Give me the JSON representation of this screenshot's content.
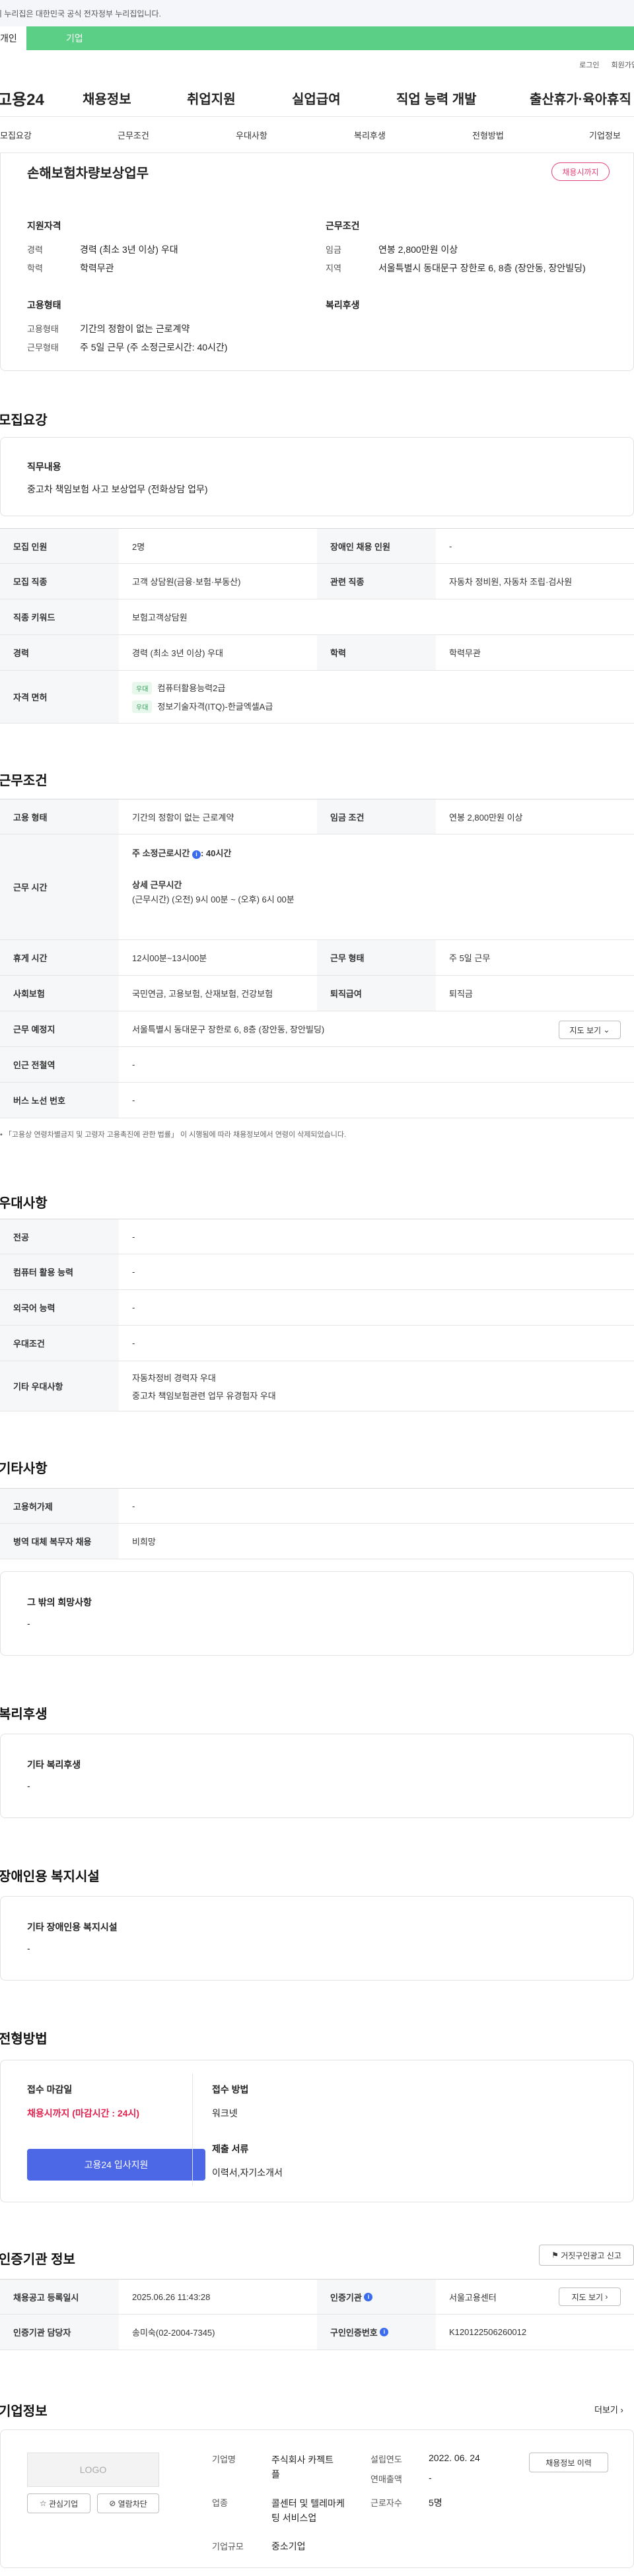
{
  "notice": "이 누리집은 대한민국 공식 전자정부 누리집입니다.",
  "tabs": [
    "개인",
    "기업"
  ],
  "util": [
    "로그인",
    "회원가입"
  ],
  "gnb": {
    "logo": "고용24",
    "menus": [
      "채용정보",
      "취업지원",
      "실업급여",
      "직업 능력 개발",
      "출산휴가·육아휴직"
    ]
  },
  "subnav": [
    "모집요강",
    "근무조건",
    "우대사항",
    "복리후생",
    "전형방법",
    "기업정보"
  ],
  "job": {
    "title": "손해보험차량보상업무",
    "status": "채용시까지",
    "qual_heading": "지원자격",
    "exp_label": "경력",
    "exp_value": "경력 (최소 3년 이상) 우대",
    "edu_label": "학력",
    "edu_value": "학력무관",
    "cond_heading": "근무조건",
    "wage_label": "임금",
    "wage_value": "연봉 2,800만원 이상",
    "region_label": "지역",
    "region_value": "서울특별시 동대문구 장한로 6, 8층 (장안동, 장안빌딩)",
    "emptype_heading": "고용형태",
    "emptype_label": "고용형태",
    "emptype_value": "기간의 정함이 없는 근로계약",
    "worktype_label": "근무형태",
    "worktype_value": "주 5일 근무 (주 소정근로시간: 40시간)",
    "welfare_heading": "복리후생"
  },
  "recruit": {
    "title": "모집요강",
    "duty_label": "직무내용",
    "duty_value": "중고차 책임보험 사고 보상업무 (전화상담 업무)",
    "rows": {
      "count_label": "모집 인원",
      "count_value": "2명",
      "disabled_label": "장애인 채용 인원",
      "disabled_value": "-",
      "job_label": "모집 직종",
      "job_value": "고객 상담원(금융·보험·부동산)",
      "related_label": "관련 직종",
      "related_value": "자동차 정비원, 자동차 조립·검사원",
      "keyword_label": "직종 키워드",
      "keyword_value": "보험고객상담원",
      "exp_label": "경력",
      "exp_value": "경력 (최소 3년 이상) 우대",
      "edu_label": "학력",
      "edu_value": "학력무관",
      "cert_label": "자격 면허",
      "certs": [
        {
          "tag": "우대",
          "name": "컴퓨터활용능력2급"
        },
        {
          "tag": "우대",
          "name": "정보기술자격(ITQ)-한글엑셀A급"
        }
      ]
    }
  },
  "work": {
    "title": "근무조건",
    "emptype_label": "고용 형태",
    "emptype_value": "기간의 정함이 없는 근로계약",
    "wage_label": "임금 조건",
    "wage_value": "연봉 2,800만원 이상",
    "hours_label": "근무 시간",
    "hours_weekly": "주 소정근로시간",
    "hours_weekly_value": ": 40시간",
    "hours_detail_title": "상세 근무시간",
    "hours_detail": "(근무시간) (오전) 9시 00분 ~ (오후) 6시 00분",
    "rest_label": "휴게 시간",
    "rest_value": "12시00분~13시00분",
    "worktype_label": "근무 형태",
    "worktype_value": "주 5일 근무",
    "insurance_label": "사회보험",
    "insurance_value": "국민연금, 고용보험, 산재보험, 건강보험",
    "retire_label": "퇴직급여",
    "retire_value": "퇴직금",
    "place_label": "근무 예정지",
    "place_value": "서울특별시 동대문구 장한로 6, 8층 (장안동, 장안빌딩)",
    "map_button": "지도 보기",
    "subway_label": "인근 전철역",
    "subway_value": "-",
    "bus_label": "버스 노선 번호",
    "bus_value": "-",
    "note": "「고용상 연령차별금지 및 고령자 고용촉진에 관한 법률」 이 시행됨에 따라 채용정보에서 연령이 삭제되었습니다."
  },
  "pref": {
    "title": "우대사항",
    "major_label": "전공",
    "major_value": "-",
    "pc_label": "컴퓨터 활용 능력",
    "pc_value": "-",
    "lang_label": "외국어 능력",
    "lang_value": "-",
    "cond_label": "우대조건",
    "cond_value": "-",
    "etc_label": "기타 우대사항",
    "etc_value1": "자동차정비 경력자 우대",
    "etc_value2": "중고차 책임보험관련 업무 유경험자 우대"
  },
  "other": {
    "title": "기타사항",
    "permit_label": "고용허가제",
    "permit_value": "-",
    "military_label": "병역 대체 복무자 채용",
    "military_value": "비희망",
    "wish_label": "그 밖의 희망사항",
    "wish_value": "-"
  },
  "welfare": {
    "title": "복리후생",
    "label": "기타 복리후생",
    "value": "-"
  },
  "disabled_fac": {
    "title": "장애인용 복지시설",
    "label": "기타 장애인용 복지시설",
    "value": "-"
  },
  "process": {
    "title": "전형방법",
    "deadline_label": "접수 마감일",
    "deadline_value": "채용시까지 (마감시간 : 24시)",
    "apply_button": "고용24 입사지원",
    "method_label": "접수 방법",
    "method_value": "워크넷",
    "docs_label": "제출 서류",
    "docs_value": "이력서,자기소개서"
  },
  "cert": {
    "title": "인증기관 정보",
    "report_button": "거짓구인광고 신고",
    "reg_label": "채용공고 등록일시",
    "reg_value": "2025.06.26 11:43:28",
    "org_label": "인증기관",
    "org_value": "서울고용센터",
    "map_button": "지도 보기",
    "manager_label": "인증기관 담당자",
    "manager_value": "송미숙(02-2004-7345)",
    "no_label": "구인인증번호",
    "no_value": "K120122506260012"
  },
  "company": {
    "title": "기업정보",
    "more": "더보기",
    "logo": "LOGO",
    "fav_button": "관심기업",
    "block_button": "열람차단",
    "name_label": "기업명",
    "name_value": "주식회사 카젝트 플",
    "biz_label": "업종",
    "biz_value": "콜센터 및 텔레마케팅 서비스업",
    "size_label": "기업규모",
    "size_value": "중소기업",
    "est_label": "설립연도",
    "est_value": "2022. 06. 24",
    "sales_label": "연매출액",
    "sales_value": "-",
    "emp_label": "근로자수",
    "emp_value": "5명",
    "history_button": "채용정보 이력"
  }
}
